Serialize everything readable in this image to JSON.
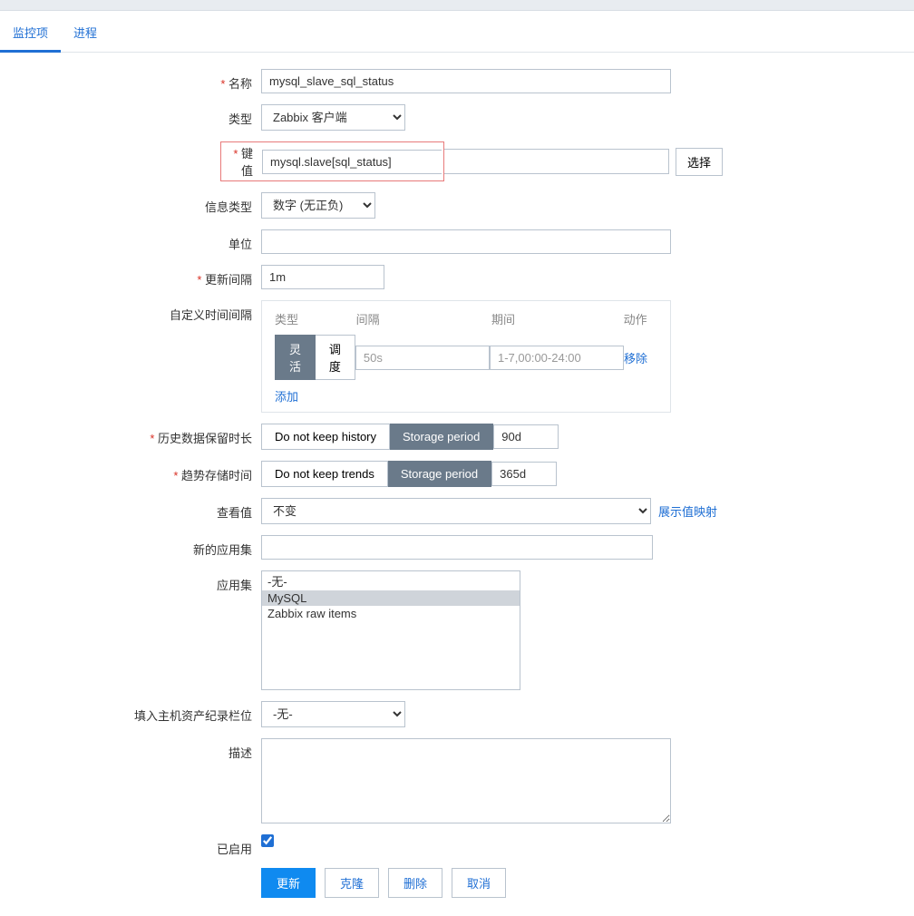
{
  "tabs": {
    "active": "监控项",
    "other": "进程"
  },
  "labels": {
    "name": "名称",
    "type": "类型",
    "key": "键值",
    "info_type": "信息类型",
    "units": "单位",
    "update_interval": "更新间隔",
    "custom_intervals": "自定义时间间隔",
    "history": "历史数据保留时长",
    "trends": "趋势存储时间",
    "show_value": "查看值",
    "new_app": "新的应用集",
    "apps": "应用集",
    "inventory": "填入主机资产纪录栏位",
    "description": "描述",
    "enabled": "已启用"
  },
  "fields": {
    "name": "mysql_slave_sql_status",
    "type": "Zabbix 客户端",
    "key": "mysql.slave[sql_status]",
    "info_type": "数字 (无正负)",
    "units": "",
    "update_interval": "1m",
    "new_app": "",
    "description": ""
  },
  "intervals": {
    "hdr_type": "类型",
    "hdr_interval": "间隔",
    "hdr_period": "期间",
    "hdr_action": "动作",
    "flex": "灵活",
    "sched": "调度",
    "int_val": "50s",
    "per_val": "1-7,00:00-24:00",
    "remove": "移除",
    "add": "添加"
  },
  "history": {
    "no_keep": "Do not keep history",
    "storage": "Storage period",
    "val": "90d"
  },
  "trends": {
    "no_keep": "Do not keep trends",
    "storage": "Storage period",
    "val": "365d"
  },
  "show_value": {
    "val": "不变",
    "link": "展示值映射"
  },
  "apps": {
    "none": "-无-",
    "mysql": "MySQL",
    "raw": "Zabbix raw items"
  },
  "inventory": {
    "val": "-无-"
  },
  "buttons": {
    "select": "选择",
    "update": "更新",
    "clone": "克隆",
    "delete": "删除",
    "cancel": "取消"
  }
}
